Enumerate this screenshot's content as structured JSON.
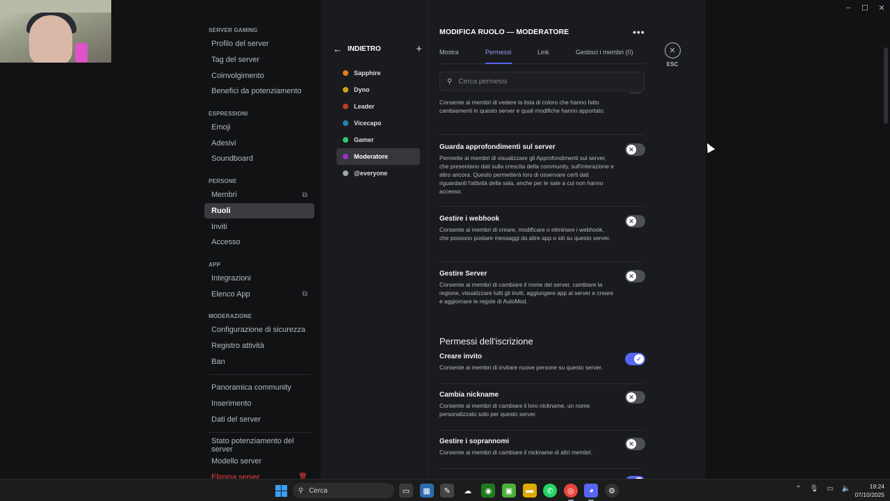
{
  "window_controls": {
    "minimize": "–",
    "maximize": "☐",
    "close": "✕"
  },
  "sidebar": {
    "sections": [
      {
        "title": "SERVER GAMING",
        "items": [
          {
            "label": "Profilo del server"
          },
          {
            "label": "Tag del server"
          },
          {
            "label": "Coinvolgimento"
          },
          {
            "label": "Benefici da potenziamento"
          }
        ]
      },
      {
        "title": "ESPRESSIONI",
        "items": [
          {
            "label": "Emoji"
          },
          {
            "label": "Adesivi"
          },
          {
            "label": "Soundboard"
          }
        ]
      },
      {
        "title": "PERSONE",
        "items": [
          {
            "label": "Membri",
            "external": true
          },
          {
            "label": "Ruoli",
            "active": true
          },
          {
            "label": "Inviti"
          },
          {
            "label": "Accesso"
          }
        ]
      },
      {
        "title": "APP",
        "items": [
          {
            "label": "Integrazioni"
          },
          {
            "label": "Elenco App",
            "external": true
          }
        ]
      },
      {
        "title": "MODERAZIONE",
        "items": [
          {
            "label": "Configurazione di sicurezza"
          },
          {
            "label": "Registro attività"
          },
          {
            "label": "Ban"
          }
        ]
      },
      {
        "title": "",
        "items": [
          {
            "label": "Panoramica community"
          },
          {
            "label": "Inserimento"
          },
          {
            "label": "Dati del server"
          }
        ]
      },
      {
        "title": "",
        "items": [
          {
            "label": "Stato potenziamento del server"
          },
          {
            "label": "Modello server"
          },
          {
            "label": "Elimina server",
            "danger": true
          }
        ]
      }
    ]
  },
  "roles": {
    "back_label": "INDIETRO",
    "add_icon": "+",
    "list": [
      {
        "name": "Sapphire",
        "color": "#e67e22"
      },
      {
        "name": "Dyno",
        "color": "#d4a017"
      },
      {
        "name": "Leader",
        "color": "#c0392b"
      },
      {
        "name": "Vicecapo",
        "color": "#2980b9"
      },
      {
        "name": "Gamer",
        "color": "#2ecc71"
      },
      {
        "name": "Moderatore",
        "color": "#9b30d0",
        "active": true
      },
      {
        "name": "@everyone",
        "color": "#99aab5"
      }
    ]
  },
  "main": {
    "title": "MODIFICA RUOLO — MODERATORE",
    "tabs": [
      {
        "label": "Mostra",
        "active": false
      },
      {
        "label": "Permessi",
        "active": true
      },
      {
        "label": "Link",
        "active": false
      },
      {
        "label": "Gestisci i membri (0)",
        "active": false
      }
    ],
    "search_placeholder": "Cerca permessi",
    "permissions": [
      {
        "title": "",
        "desc": "Consente ai membri di vedere la lista di coloro che hanno fatto cambiamenti in questo server e quali modifiche hanno apportato.",
        "enabled": false
      },
      {
        "title": "Guarda approfondimenti sul server",
        "desc": "Permette ai membri di visualizzare gli Approfondimenti sul server, che presentano dati sulla crescita della community, sull'interazione e altro ancora. Questo permetterà loro di osservare certi dati riguardanti l'attività della sala, anche per le sale a cui non hanno accesso.",
        "enabled": false
      },
      {
        "title": "Gestire i webhook",
        "desc": "Consente ai membri di creare, modificare o eliminare i webhook, che possono postare messaggi da altre app o siti su questo server.",
        "enabled": false
      },
      {
        "title": "Gestire Server",
        "desc": "Consente ai membri di cambiare il nome del server, cambiare la regione, visualizzare tutti gli inviti, aggiungere app al server e creare e aggiornare le regole di AutoMod.",
        "enabled": false
      }
    ],
    "group_title": "Permessi dell'iscrizione",
    "membership_permissions": [
      {
        "title": "Creare invito",
        "desc": "Consente ai membri di invitare nuove persone su questo server.",
        "enabled": true
      },
      {
        "title": "Cambia nickname",
        "desc": "Consente ai membri di cambiare il loro nickname, un nome personalizzato solo per questo server.",
        "enabled": false
      },
      {
        "title": "Gestire i soprannomi",
        "desc": "Consente ai membri di cambiare il nickname di altri membri.",
        "enabled": false
      }
    ],
    "esc_label": "ESC"
  },
  "taskbar": {
    "search_label": "Cerca",
    "clock_time": "19:24",
    "clock_date": "07/10/2025"
  }
}
